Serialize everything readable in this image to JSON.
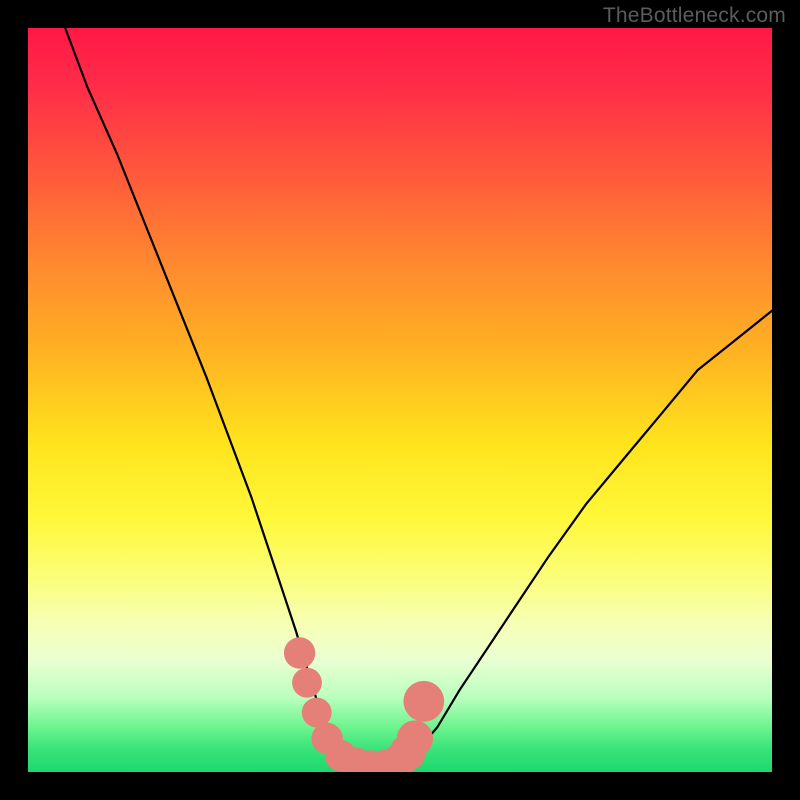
{
  "watermark": {
    "text": "TheBottleneck.com"
  },
  "colors": {
    "curve": "#000000",
    "marker_fill": "#e58079",
    "marker_stroke": "#d56a63",
    "background_black": "#000000"
  },
  "chart_data": {
    "type": "line",
    "title": "",
    "xlabel": "",
    "ylabel": "",
    "xlim": [
      0,
      100
    ],
    "ylim": [
      0,
      100
    ],
    "grid": false,
    "legend": false,
    "series": [
      {
        "name": "bottleneck-curve",
        "x": [
          5,
          8,
          12,
          16,
          20,
          24,
          27,
          30,
          32,
          34,
          36,
          37.5,
          39,
          40.5,
          42,
          44,
          46,
          48,
          50,
          52,
          55,
          58,
          62,
          66,
          70,
          75,
          80,
          85,
          90,
          95,
          100
        ],
        "y": [
          100,
          92,
          83,
          73,
          63,
          53,
          45,
          37,
          31,
          25,
          19,
          14,
          9,
          5,
          2.5,
          1,
          0.5,
          0.5,
          1,
          2.5,
          6,
          11,
          17,
          23,
          29,
          36,
          42,
          48,
          54,
          58,
          62
        ]
      }
    ],
    "markers": [
      {
        "x": 36.5,
        "y": 16,
        "r": 1.5
      },
      {
        "x": 37.5,
        "y": 12,
        "r": 1.4
      },
      {
        "x": 38.8,
        "y": 8,
        "r": 1.4
      },
      {
        "x": 40.2,
        "y": 4.5,
        "r": 1.5
      },
      {
        "x": 42.0,
        "y": 2.2,
        "r": 1.5
      },
      {
        "x": 44.0,
        "y": 1.1,
        "r": 1.6
      },
      {
        "x": 46.0,
        "y": 0.7,
        "r": 1.6
      },
      {
        "x": 48.0,
        "y": 0.8,
        "r": 1.6
      },
      {
        "x": 49.8,
        "y": 1.4,
        "r": 1.7
      },
      {
        "x": 51.0,
        "y": 2.6,
        "r": 1.8
      },
      {
        "x": 52.0,
        "y": 4.5,
        "r": 1.8
      },
      {
        "x": 53.2,
        "y": 9.5,
        "r": 2.1
      }
    ]
  }
}
